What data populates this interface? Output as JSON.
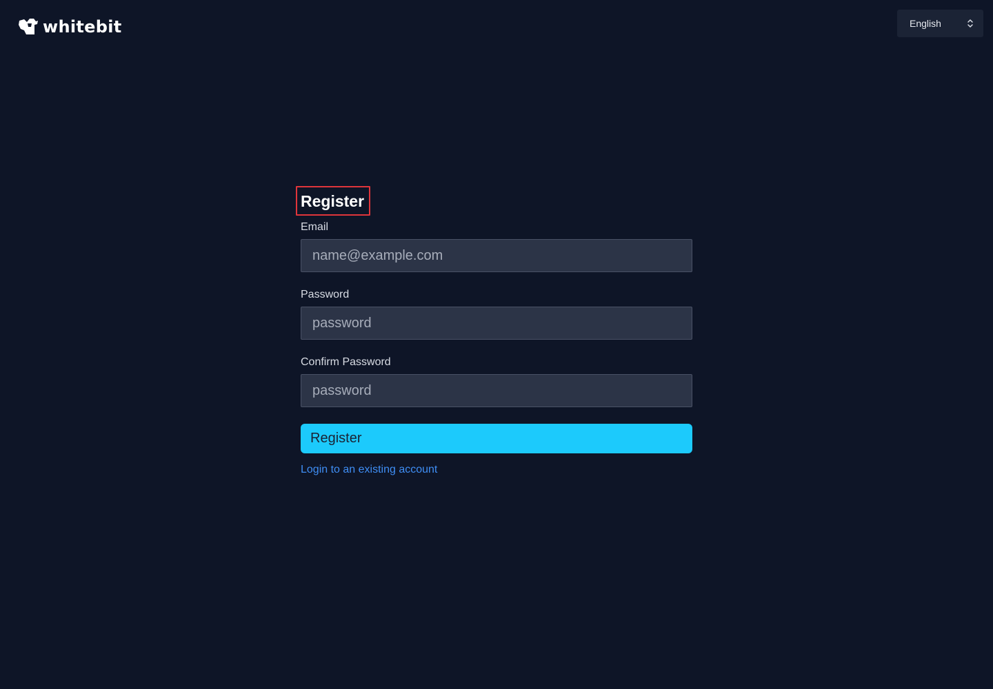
{
  "header": {
    "logo_text": "whitebit",
    "language": {
      "selected": "English",
      "icon": "chevron-up-down-icon"
    }
  },
  "form": {
    "title": "Register",
    "email": {
      "label": "Email",
      "placeholder": "name@example.com",
      "value": ""
    },
    "password": {
      "label": "Password",
      "placeholder": "password",
      "value": ""
    },
    "confirm_password": {
      "label": "Confirm Password",
      "placeholder": "password",
      "value": ""
    },
    "submit_label": "Register",
    "login_link": "Login to an existing account"
  },
  "colors": {
    "background": "#0e1527",
    "input_background": "#2c3447",
    "button_accent": "#1ccafc",
    "link": "#3f8ef5",
    "highlight_border": "#e0353b"
  }
}
